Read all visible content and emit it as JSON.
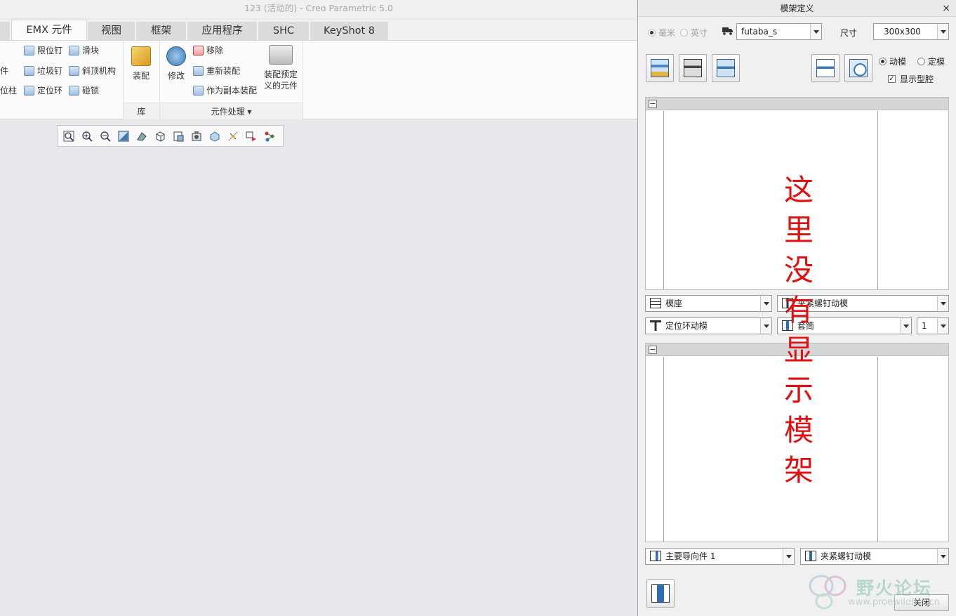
{
  "window": {
    "title": "123 (活动的) - Creo Parametric 5.0"
  },
  "tabs": [
    {
      "label": "EMX 元件",
      "active": true
    },
    {
      "label": "视图"
    },
    {
      "label": "框架"
    },
    {
      "label": "应用程序"
    },
    {
      "label": "SHC"
    },
    {
      "label": "KeyShot 8"
    }
  ],
  "ribbon": {
    "left_col1": [
      "",
      "件",
      "位柱"
    ],
    "col2": [
      "限位钉",
      "垃圾钉",
      "定位环"
    ],
    "col3": [
      "滑块",
      "斜顶机构",
      "碰锁"
    ],
    "library": {
      "button": "装配",
      "group": "库"
    },
    "modify": {
      "button": "修改"
    },
    "component_actions": [
      "移除",
      "重新装配",
      "作为副本装配"
    ],
    "predefined": {
      "line1": "装配预定",
      "line2": "义的元件"
    },
    "component_group": "元件处理",
    "dropdown_glyph": "▾"
  },
  "dialog": {
    "title": "模架定义",
    "close_glyph": "×",
    "units": {
      "mm": "毫米",
      "inch": "英寸"
    },
    "vendor": "futaba_s",
    "size_label": "尺寸",
    "size_value": "300x300",
    "mode": {
      "moving": "动模",
      "fixed": "定模",
      "selected": "动模"
    },
    "show_cavity": {
      "label": "显示型腔",
      "checked": true,
      "glyph": "✓"
    },
    "panel_toggle": "−",
    "combos_row1": [
      "模座",
      "夹紧螺钉动模"
    ],
    "combos_row2": [
      "定位环动模",
      "套筒",
      "1"
    ],
    "combos_bottom": [
      "主要导向件 1",
      "夹紧螺钉动模"
    ],
    "close_button": "关闭"
  },
  "annotation": {
    "chars": [
      "这",
      "里",
      "没",
      "有",
      "显",
      "示",
      "模",
      "架"
    ],
    "color": "#e01010"
  },
  "watermark": {
    "text": "野火论坛",
    "url": "www.proewildfire.cn"
  }
}
